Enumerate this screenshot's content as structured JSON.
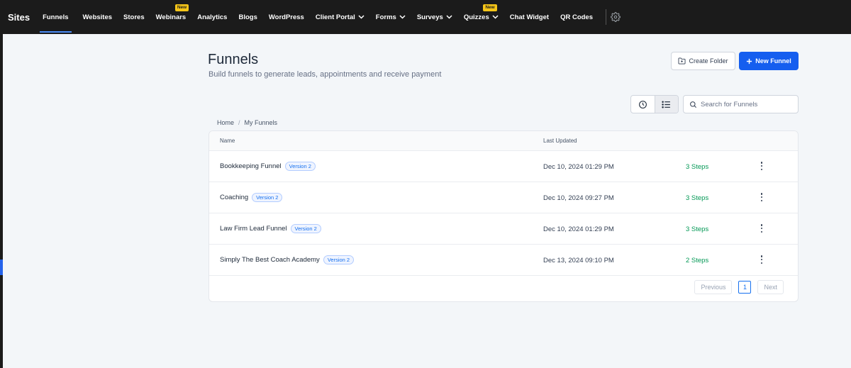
{
  "brand": "Sites",
  "nav": {
    "items": [
      {
        "label": "Funnels"
      },
      {
        "label": "Websites"
      },
      {
        "label": "Stores"
      },
      {
        "label": "Webinars",
        "badge": "New"
      },
      {
        "label": "Analytics"
      },
      {
        "label": "Blogs"
      },
      {
        "label": "WordPress"
      },
      {
        "label": "Client Portal"
      },
      {
        "label": "Forms"
      },
      {
        "label": "Surveys"
      },
      {
        "label": "Quizzes",
        "badge": "New"
      },
      {
        "label": "Chat Widget"
      },
      {
        "label": "QR Codes"
      }
    ],
    "active": "Funnels"
  },
  "header": {
    "title": "Funnels",
    "subtitle": "Build funnels to generate leads, appointments and receive payment",
    "create_folder_label": "Create Folder",
    "new_funnel_label": "New Funnel"
  },
  "search": {
    "placeholder": "Search for Funnels"
  },
  "breadcrumb": {
    "home": "Home",
    "separator": "/",
    "current": "My Funnels"
  },
  "table": {
    "headers": {
      "name": "Name",
      "last_updated": "Last Updated"
    },
    "rows": [
      {
        "name": "Bookkeeping Funnel",
        "version": "Version 2",
        "updated": "Dec 10, 2024 01:29 PM",
        "steps": "3 Steps"
      },
      {
        "name": "Coaching",
        "version": "Version 2",
        "updated": "Dec 10, 2024 09:27 PM",
        "steps": "3 Steps"
      },
      {
        "name": "Law Firm Lead Funnel",
        "version": "Version 2",
        "updated": "Dec 10, 2024 01:29 PM",
        "steps": "3 Steps"
      },
      {
        "name": "Simply The Best Coach Academy",
        "version": "Version 2",
        "updated": "Dec 13, 2024 09:10 PM",
        "steps": "2 Steps"
      }
    ]
  },
  "pagination": {
    "previous": "Previous",
    "current_page": "1",
    "next": "Next"
  },
  "colors": {
    "primary": "#155eef",
    "nav_bg": "#1b1b1b",
    "steps_green": "#039855",
    "badge_yellow": "#f5c518"
  }
}
